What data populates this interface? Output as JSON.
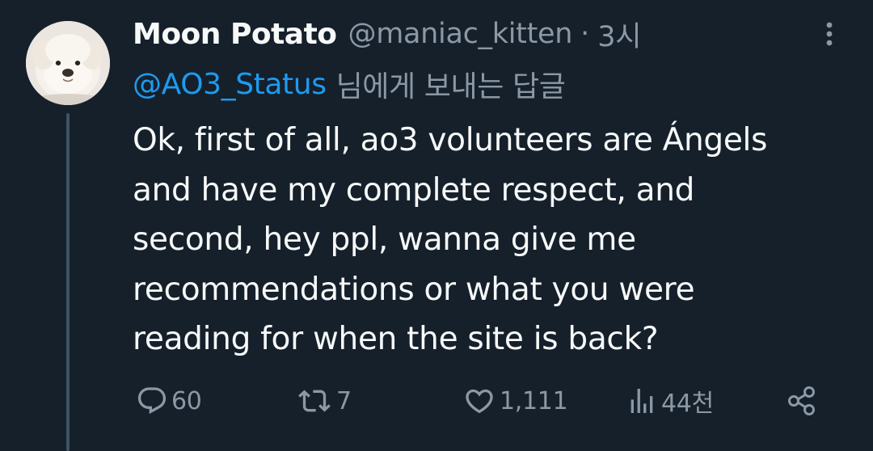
{
  "tweet": {
    "display_name": "Moon Potato",
    "handle": "@maniac_kitten",
    "separator": "·",
    "time": "3시",
    "replying_to": {
      "mention": "@AO3_Status",
      "suffix": "님에게 보내는 답글"
    },
    "text": "Ok, first of all, ao3 volunteers are Ángels\nand have my complete respect, and\nsecond, hey ppl, wanna give me\nrecommendations or what you were\nreading for when the site is back?"
  },
  "actions": {
    "reply_count": "60",
    "retweet_count": "7",
    "like_count": "1,111",
    "views_count": "44천"
  },
  "icons": {
    "more": "more-vertical-icon",
    "reply": "reply-bubble-icon",
    "retweet": "retweet-icon",
    "like": "heart-icon",
    "views": "analytics-bars-icon",
    "share": "share-nodes-icon"
  },
  "colors": {
    "background": "#15202b",
    "text_primary": "#f7f9f9",
    "text_secondary": "#8b98a5",
    "mention": "#1d9bf0",
    "thread_line": "#3d5466"
  }
}
